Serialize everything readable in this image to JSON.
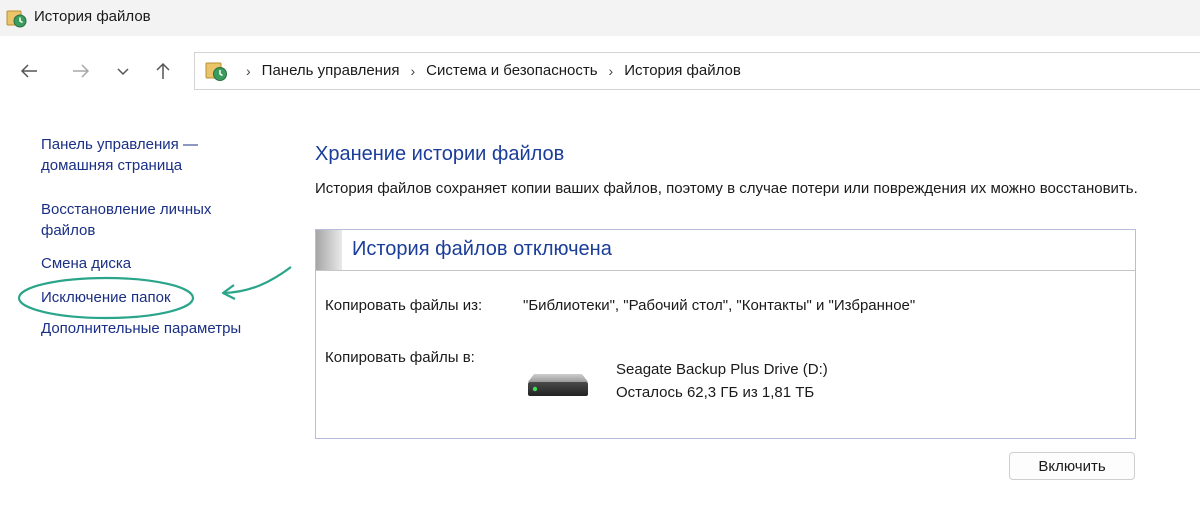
{
  "window": {
    "title": "История файлов",
    "icon": "file-history-icon"
  },
  "nav": {
    "back_icon": "back-arrow-icon",
    "forward_icon": "forward-arrow-icon",
    "recent_icon": "chevron-down-icon",
    "up_icon": "up-arrow-icon"
  },
  "breadcrumb": {
    "items": [
      "Панель управления",
      "Система и безопасность",
      "История файлов"
    ]
  },
  "sidebar": {
    "items": [
      {
        "label": "Панель управления — домашняя страница"
      },
      {
        "label": "Восстановление личных файлов"
      },
      {
        "label": "Смена диска"
      },
      {
        "label": "Исключение папок",
        "highlighted": true
      },
      {
        "label": "Дополнительные параметры"
      }
    ],
    "annotation_color": "#2aa58a"
  },
  "main": {
    "heading": "Хранение истории файлов",
    "description": "История файлов сохраняет копии ваших файлов, поэтому в случае потери или повреждения их можно восстановить."
  },
  "status_panel": {
    "status": "История файлов отключена",
    "copy_from_label": "Копировать файлы из:",
    "copy_from_value": "\"Библиотеки\", \"Рабочий стол\", \"Контакты\" и \"Избранное\"",
    "copy_to_label": "Копировать файлы в:",
    "drive": {
      "icon": "hard-drive-icon",
      "name": "Seagate Backup Plus Drive (D:)",
      "space": "Осталось 62,3 ГБ из 1,81 ТБ"
    }
  },
  "actions": {
    "enable_label": "Включить"
  },
  "colors": {
    "link": "#1a2f85",
    "heading": "#1a3d99",
    "annotation": "#2aa58a"
  }
}
